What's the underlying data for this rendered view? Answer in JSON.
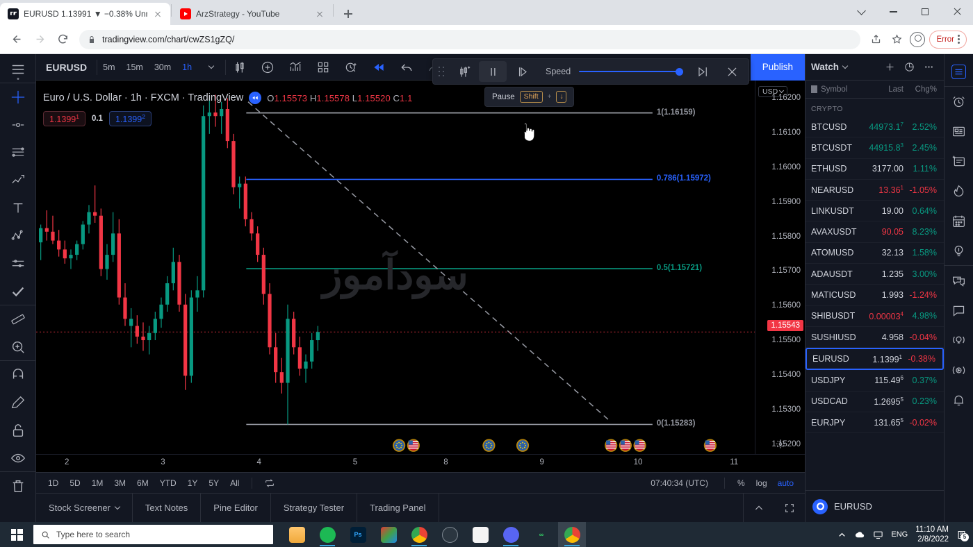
{
  "browser": {
    "tabs": [
      {
        "title": "EURUSD 1.13991 ▼ −0.38% Unn:",
        "favicon": "tradingview-icon",
        "active": true
      },
      {
        "title": "ArzStrategy - YouTube",
        "favicon": "youtube-icon",
        "active": false
      }
    ],
    "url": "tradingview.com/chart/cwZS1gZQ/",
    "error_label": "Error"
  },
  "topbar": {
    "symbol": "EURUSD",
    "timeframes": [
      "5m",
      "15m",
      "30m",
      "1h"
    ],
    "active_timeframe": "1h",
    "publish_label": "Publish"
  },
  "replay": {
    "speed_label": "Speed",
    "tooltip_label": "Pause",
    "tooltip_key1": "Shift",
    "tooltip_plus": "+",
    "tooltip_key2": "↓"
  },
  "legend": {
    "title": "Euro / U.S. Dollar · 1h · FXCM · TradingView",
    "ohlc": [
      {
        "k": "O",
        "v": "1.15573"
      },
      {
        "k": "H",
        "v": "1.15578"
      },
      {
        "k": "L",
        "v": "1.15520"
      },
      {
        "k": "C",
        "v": "1.1"
      }
    ],
    "ohlc_tail": "%)",
    "sell_price": "1.1399",
    "sell_sup": "1",
    "spread": "0.1",
    "buy_price": "1.1399",
    "buy_sup": "2",
    "watermark": "سودآموز"
  },
  "price_axis": {
    "currency": "USD",
    "ticks": [
      "1.16200",
      "1.16100",
      "1.16000",
      "1.15900",
      "1.15800",
      "1.15700",
      "1.15600",
      "1.15500",
      "1.15400",
      "1.15300",
      "1.15200"
    ],
    "last_price": "1.15543"
  },
  "fib_levels": [
    {
      "label": "1(1.16159)",
      "color": "#9598a1"
    },
    {
      "label": "0.786(1.15972)",
      "color": "#2962ff"
    },
    {
      "label": "0.5(1.15721)",
      "color": "#089981"
    },
    {
      "label": "0(1.15283)",
      "color": "#9598a1"
    }
  ],
  "time_axis": {
    "ticks": [
      "2",
      "3",
      "4",
      "5",
      "8",
      "9",
      "10",
      "11"
    ]
  },
  "bottom_tools": {
    "ranges": [
      "1D",
      "5D",
      "1M",
      "3M",
      "6M",
      "YTD",
      "1Y",
      "5Y",
      "All"
    ],
    "clock": "07:40:34 (UTC)",
    "percent": "%",
    "log": "log",
    "auto": "auto"
  },
  "panel_tabs": [
    {
      "label": "Stock Screener",
      "caret": true
    },
    {
      "label": "Text Notes",
      "caret": false
    },
    {
      "label": "Pine Editor",
      "caret": false
    },
    {
      "label": "Strategy Tester",
      "caret": false
    },
    {
      "label": "Trading Panel",
      "caret": false
    }
  ],
  "watchlist": {
    "title": "Watch",
    "columns": {
      "symbol": "Symbol",
      "last": "Last",
      "chg": "Chg%"
    },
    "group": "CRYPTO",
    "rows": [
      {
        "symbol": "BTCUSD",
        "last": "44973.1",
        "last_sup": "7",
        "last_dir": "up",
        "chg": "2.52%",
        "chg_dir": "up"
      },
      {
        "symbol": "BTCUSDT",
        "last": "44915.8",
        "last_sup": "3",
        "last_dir": "up",
        "chg": "2.45%",
        "chg_dir": "up"
      },
      {
        "symbol": "ETHUSD",
        "last": "3177.00",
        "last_sup": "",
        "last_dir": "neu",
        "chg": "1.11%",
        "chg_dir": "up"
      },
      {
        "symbol": "NEARUSD",
        "last": "13.36",
        "last_sup": "1",
        "last_dir": "down",
        "chg": "-1.05%",
        "chg_dir": "down"
      },
      {
        "symbol": "LINKUSDT",
        "last": "19.00",
        "last_sup": "",
        "last_dir": "neu",
        "chg": "0.64%",
        "chg_dir": "up"
      },
      {
        "symbol": "AVAXUSDT",
        "last": "90.05",
        "last_sup": "",
        "last_dir": "down",
        "chg": "8.23%",
        "chg_dir": "up"
      },
      {
        "symbol": "ATOMUSD",
        "last": "32.13",
        "last_sup": "",
        "last_dir": "neu",
        "chg": "1.58%",
        "chg_dir": "up"
      },
      {
        "symbol": "ADAUSDT",
        "last": "1.235",
        "last_sup": "",
        "last_dir": "neu",
        "chg": "3.00%",
        "chg_dir": "up"
      },
      {
        "symbol": "MATICUSD",
        "last": "1.993",
        "last_sup": "",
        "last_dir": "neu",
        "chg": "-1.24%",
        "chg_dir": "down"
      },
      {
        "symbol": "SHIBUSDT",
        "last": "0.00003",
        "last_sup": "4",
        "last_dir": "down",
        "chg": "4.98%",
        "chg_dir": "up"
      },
      {
        "symbol": "SUSHIUSD",
        "last": "4.958",
        "last_sup": "",
        "last_dir": "neu",
        "chg": "-0.04%",
        "chg_dir": "down"
      },
      {
        "symbol": "EURUSD",
        "last": "1.1399",
        "last_sup": "1",
        "last_dir": "neu",
        "chg": "-0.38%",
        "chg_dir": "down",
        "selected": true
      },
      {
        "symbol": "USDJPY",
        "last": "115.49",
        "last_sup": "6",
        "last_dir": "neu",
        "chg": "0.37%",
        "chg_dir": "up"
      },
      {
        "symbol": "USDCAD",
        "last": "1.2695",
        "last_sup": "5",
        "last_dir": "neu",
        "chg": "0.23%",
        "chg_dir": "up"
      },
      {
        "symbol": "EURJPY",
        "last": "131.65",
        "last_sup": "5",
        "last_dir": "neu",
        "chg": "-0.02%",
        "chg_dir": "down"
      }
    ],
    "footer_symbol": "EURUSD"
  },
  "taskbar": {
    "search_placeholder": "Type here to search",
    "language": "ENG",
    "time": "11:10 AM",
    "date": "2/8/2022",
    "notif_count": "5"
  },
  "chart_data": {
    "type": "candlestick",
    "title": "Euro / U.S. Dollar · 1h · FXCM · TradingView",
    "symbol": "EURUSD",
    "interval": "1h",
    "exchange": "FXCM",
    "ylim": [
      1.152,
      1.1625
    ],
    "ylabel": "USD",
    "xlabel": "",
    "grid": false,
    "last_price": 1.15543,
    "ytick_values": [
      1.162,
      1.161,
      1.16,
      1.159,
      1.158,
      1.157,
      1.156,
      1.155,
      1.154,
      1.153,
      1.152
    ],
    "xtick_labels": [
      "2",
      "3",
      "4",
      "5",
      "8",
      "9",
      "10",
      "11"
    ],
    "overlays": [
      {
        "kind": "fib_retracement",
        "level": 1.0,
        "price": 1.16159,
        "label": "1(1.16159)",
        "color": "#9598a1"
      },
      {
        "kind": "fib_retracement",
        "level": 0.786,
        "price": 1.15972,
        "label": "0.786(1.15972)",
        "color": "#2962ff"
      },
      {
        "kind": "fib_retracement",
        "level": 0.5,
        "price": 1.15721,
        "label": "0.5(1.15721)",
        "color": "#089981"
      },
      {
        "kind": "fib_retracement",
        "level": 0.0,
        "price": 1.15283,
        "label": "0(1.15283)",
        "color": "#9598a1"
      },
      {
        "kind": "trendline_dashed",
        "from": [
          0.295,
          1.1619
        ],
        "to": [
          0.8,
          1.1529
        ],
        "color": "#9598a1"
      }
    ],
    "candles": [
      {
        "o": 1.15795,
        "h": 1.15845,
        "l": 1.15745,
        "c": 1.15835,
        "d": "up"
      },
      {
        "o": 1.15835,
        "h": 1.15885,
        "l": 1.158,
        "c": 1.15825,
        "d": "down"
      },
      {
        "o": 1.15825,
        "h": 1.1587,
        "l": 1.1579,
        "c": 1.158,
        "d": "down"
      },
      {
        "o": 1.158,
        "h": 1.1583,
        "l": 1.15755,
        "c": 1.15775,
        "d": "down"
      },
      {
        "o": 1.15775,
        "h": 1.158,
        "l": 1.15735,
        "c": 1.1575,
        "d": "down"
      },
      {
        "o": 1.1575,
        "h": 1.15775,
        "l": 1.1572,
        "c": 1.1576,
        "d": "up"
      },
      {
        "o": 1.1576,
        "h": 1.158,
        "l": 1.15745,
        "c": 1.1579,
        "d": "up"
      },
      {
        "o": 1.1579,
        "h": 1.15855,
        "l": 1.15775,
        "c": 1.15845,
        "d": "up"
      },
      {
        "o": 1.15845,
        "h": 1.159,
        "l": 1.1582,
        "c": 1.1588,
        "d": "up"
      },
      {
        "o": 1.1588,
        "h": 1.15955,
        "l": 1.1585,
        "c": 1.1587,
        "d": "down"
      },
      {
        "o": 1.1587,
        "h": 1.1589,
        "l": 1.157,
        "c": 1.1572,
        "d": "down"
      },
      {
        "o": 1.1572,
        "h": 1.1579,
        "l": 1.1569,
        "c": 1.1576,
        "d": "up"
      },
      {
        "o": 1.1576,
        "h": 1.1588,
        "l": 1.1574,
        "c": 1.1582,
        "d": "up"
      },
      {
        "o": 1.1582,
        "h": 1.1586,
        "l": 1.1562,
        "c": 1.1564,
        "d": "down"
      },
      {
        "o": 1.1564,
        "h": 1.1568,
        "l": 1.1556,
        "c": 1.1558,
        "d": "down"
      },
      {
        "o": 1.1558,
        "h": 1.1561,
        "l": 1.155,
        "c": 1.1556,
        "d": "up"
      },
      {
        "o": 1.1556,
        "h": 1.1559,
        "l": 1.1551,
        "c": 1.1553,
        "d": "down"
      },
      {
        "o": 1.1553,
        "h": 1.1557,
        "l": 1.1549,
        "c": 1.1552,
        "d": "down"
      },
      {
        "o": 1.1552,
        "h": 1.1556,
        "l": 1.1548,
        "c": 1.1554,
        "d": "up"
      },
      {
        "o": 1.1554,
        "h": 1.156,
        "l": 1.1552,
        "c": 1.1558,
        "d": "up"
      },
      {
        "o": 1.1558,
        "h": 1.1564,
        "l": 1.15555,
        "c": 1.1562,
        "d": "up"
      },
      {
        "o": 1.1562,
        "h": 1.157,
        "l": 1.156,
        "c": 1.1568,
        "d": "up"
      },
      {
        "o": 1.1568,
        "h": 1.1578,
        "l": 1.1566,
        "c": 1.1574,
        "d": "up"
      },
      {
        "o": 1.1574,
        "h": 1.1576,
        "l": 1.156,
        "c": 1.1562,
        "d": "down"
      },
      {
        "o": 1.1562,
        "h": 1.1565,
        "l": 1.1538,
        "c": 1.1542,
        "d": "down"
      },
      {
        "o": 1.1542,
        "h": 1.1566,
        "l": 1.154,
        "c": 1.1564,
        "d": "up"
      },
      {
        "o": 1.1564,
        "h": 1.157,
        "l": 1.156,
        "c": 1.1566,
        "d": "up"
      },
      {
        "o": 1.1566,
        "h": 1.1618,
        "l": 1.1564,
        "c": 1.1615,
        "d": "up"
      },
      {
        "o": 1.1615,
        "h": 1.162,
        "l": 1.161,
        "c": 1.1616,
        "d": "up"
      },
      {
        "o": 1.1616,
        "h": 1.1621,
        "l": 1.1612,
        "c": 1.1615,
        "d": "down"
      },
      {
        "o": 1.1615,
        "h": 1.1619,
        "l": 1.161,
        "c": 1.1617,
        "d": "up"
      },
      {
        "o": 1.1617,
        "h": 1.162,
        "l": 1.1606,
        "c": 1.1608,
        "d": "down"
      },
      {
        "o": 1.1608,
        "h": 1.161,
        "l": 1.1593,
        "c": 1.1595,
        "d": "down"
      },
      {
        "o": 1.1595,
        "h": 1.1598,
        "l": 1.1589,
        "c": 1.1596,
        "d": "up"
      },
      {
        "o": 1.1596,
        "h": 1.1598,
        "l": 1.1584,
        "c": 1.1586,
        "d": "down"
      },
      {
        "o": 1.1586,
        "h": 1.1588,
        "l": 1.158,
        "c": 1.1582,
        "d": "down"
      },
      {
        "o": 1.1582,
        "h": 1.1584,
        "l": 1.1574,
        "c": 1.1576,
        "d": "down"
      },
      {
        "o": 1.1576,
        "h": 1.1578,
        "l": 1.1562,
        "c": 1.1565,
        "d": "down"
      },
      {
        "o": 1.1565,
        "h": 1.1568,
        "l": 1.1548,
        "c": 1.155,
        "d": "down"
      },
      {
        "o": 1.155,
        "h": 1.1554,
        "l": 1.154,
        "c": 1.1543,
        "d": "down"
      },
      {
        "o": 1.1543,
        "h": 1.1547,
        "l": 1.1537,
        "c": 1.154,
        "d": "down"
      },
      {
        "o": 1.154,
        "h": 1.1562,
        "l": 1.15283,
        "c": 1.1558,
        "d": "up"
      },
      {
        "o": 1.1558,
        "h": 1.156,
        "l": 1.1548,
        "c": 1.155,
        "d": "down"
      },
      {
        "o": 1.155,
        "h": 1.1553,
        "l": 1.1542,
        "c": 1.1544,
        "d": "down"
      },
      {
        "o": 1.1544,
        "h": 1.1548,
        "l": 1.154,
        "c": 1.1546,
        "d": "up"
      },
      {
        "o": 1.1546,
        "h": 1.1554,
        "l": 1.1544,
        "c": 1.1552,
        "d": "up"
      },
      {
        "o": 1.1552,
        "h": 1.1556,
        "l": 1.1549,
        "c": 1.15543,
        "d": "up"
      }
    ],
    "economic_events": [
      {
        "x": 0.505,
        "flag": "EU"
      },
      {
        "x": 0.525,
        "flag": "US"
      },
      {
        "x": 0.63,
        "flag": "EU"
      },
      {
        "x": 0.677,
        "flag": "EU"
      },
      {
        "x": 0.8,
        "flag": "US"
      },
      {
        "x": 0.82,
        "flag": "US"
      },
      {
        "x": 0.84,
        "flag": "US"
      },
      {
        "x": 0.938,
        "flag": "US"
      }
    ]
  }
}
